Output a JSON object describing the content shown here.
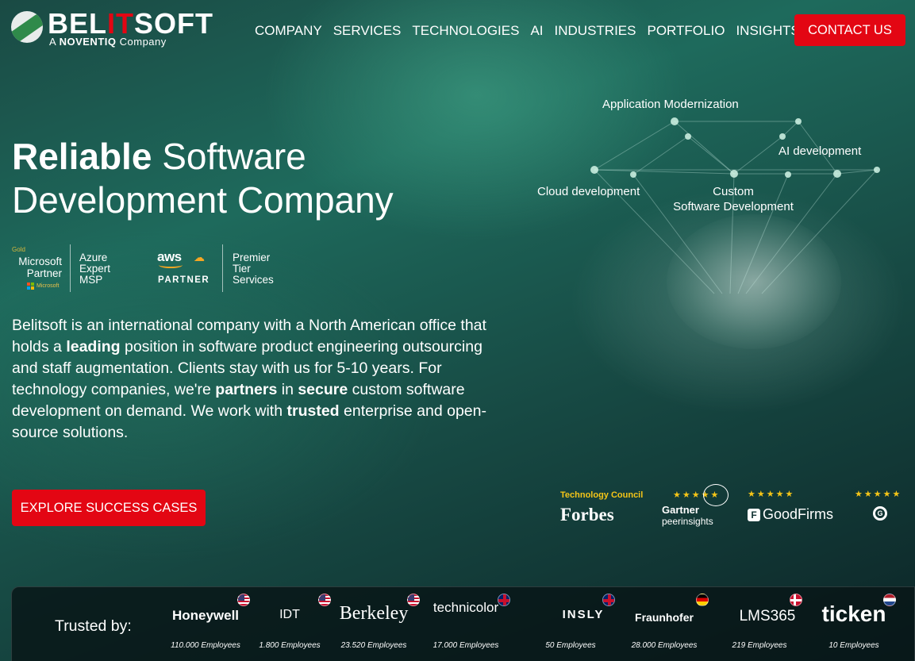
{
  "header": {
    "logo_prefix": "BEL",
    "logo_highlight": "IT",
    "logo_suffix": "SOFT",
    "logo_sub_a": "A",
    "logo_sub_brand": "NOVENTIQ",
    "logo_sub_b": "Company",
    "nav": [
      "COMPANY",
      "SERVICES",
      "TECHNOLOGIES",
      "AI",
      "INDUSTRIES",
      "PORTFOLIO",
      "INSIGHTS"
    ],
    "contact_label": "CONTACT US"
  },
  "hero": {
    "title_bold": "Reliable",
    "title_rest": "Software",
    "title_line2": "Development Company",
    "description": [
      {
        "t": "Belitsoft is an international company with a North American office that holds a ",
        "b": false
      },
      {
        "t": "leading",
        "b": true
      },
      {
        "t": " position in software product engineering outsourcing and staff augmentation. Clients stay with us for 5-10 years. For technology companies, we're ",
        "b": false
      },
      {
        "t": "partners",
        "b": true
      },
      {
        "t": " in ",
        "b": false
      },
      {
        "t": "secure",
        "b": true
      },
      {
        "t": " custom software development on demand. We work with ",
        "b": false
      },
      {
        "t": "trusted",
        "b": true
      },
      {
        "t": " enterprise and open-source solutions.",
        "b": false
      }
    ],
    "cta_label": "EXPLORE SUCCESS CASES"
  },
  "badges": {
    "ms_gold": "Gold",
    "ms_line1": "Microsoft",
    "ms_line2": "Partner",
    "ms_small": "Microsoft",
    "azure_line1": "Azure",
    "azure_line2": "Expert",
    "azure_line3": "MSP",
    "aws_word": "aws",
    "aws_partner": "PARTNER",
    "premier_line1": "Premier",
    "premier_line2": "Tier",
    "premier_line3": "Services"
  },
  "network": {
    "label_app": "Application Modernization",
    "label_ai": "AI development",
    "label_cloud": "Cloud development",
    "label_custom_1": "Custom",
    "label_custom_2": "Software Development"
  },
  "ratings": {
    "tech_council": "Technology Council",
    "forbes": "Forbes",
    "gartner": "Gartner",
    "gartner_sub": "peerinsights",
    "goodfirms": "GoodFirms",
    "g2": "G",
    "stars": "★★★★★"
  },
  "trusted": {
    "label": "Trusted by:",
    "clients": [
      {
        "name": "Honeywell",
        "employees": "110.000 Employees",
        "flag": "us"
      },
      {
        "name": "IDT",
        "employees": "1.800 Employees",
        "flag": "us"
      },
      {
        "name": "Berkeley",
        "employees": "23.520 Employees",
        "flag": "us"
      },
      {
        "name": "technicolor",
        "employees": "17.000 Employees",
        "flag": "gb"
      },
      {
        "name": "INSLY",
        "employees": "50 Employees",
        "flag": "gb"
      },
      {
        "name": "Fraunhofer",
        "employees": "28.000 Employees",
        "flag": "de"
      },
      {
        "name": "LMS365",
        "employees": "219 Employees",
        "flag": "dk"
      },
      {
        "name": "ticken",
        "employees": "10 Employees",
        "flag": "nl"
      }
    ]
  }
}
